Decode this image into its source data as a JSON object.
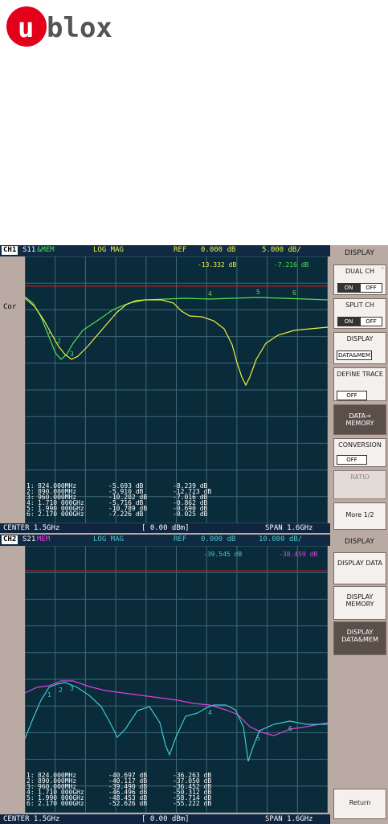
{
  "brand": {
    "name": "ublox",
    "logo_color": "#e2001a"
  },
  "ch1": {
    "label": "CH1",
    "trace": "S11",
    "trace_mem": "&MEM",
    "format": "LOG MAG",
    "ref_label": "REF",
    "ref_value": "0.000 dB",
    "scale": "5.000 dB/",
    "marker_readout_1": "-13.332 dB",
    "marker_readout_2": "-7.216 dB",
    "cor": "Cor",
    "center": "CENTER 1.5GHz",
    "power": "[ 0.00 dBm]",
    "span": "SPAN 1.6GHz",
    "markers": [
      {
        "n": "1:",
        "freq": "824.000MHz",
        "a": "-5.693 dB",
        "b": "-8.239 dB"
      },
      {
        "n": "2:",
        "freq": "890.000MHz",
        "a": "-5.910 dB",
        "b": "-12.723 dB"
      },
      {
        "n": "3:",
        "freq": "960.000MHz",
        "a": "-10.202 dB",
        "b": "-7.016 dB"
      },
      {
        "n": "4:",
        "freq": "1.710 000GHz",
        "a": "-5.716 dB",
        "b": "-0.862 dB"
      },
      {
        "n": "5:",
        "freq": "1.990 000GHz",
        "a": "-10.789 dB",
        "b": "-0.690 dB"
      },
      {
        "n": "6:",
        "freq": "2.170 000GHz",
        "a": "-7.226 dB",
        "b": "-0.025 dB"
      }
    ]
  },
  "ch2": {
    "label": "CH2",
    "trace": "S21",
    "trace_mem": "MEM",
    "format": "LOG MAG",
    "ref_label": "REF",
    "ref_value": "0.000 dB",
    "scale": "10.000 dB/",
    "marker_readout_1": "-39.545 dB",
    "marker_readout_2": "-38.459 dB",
    "center": "CENTER 1.5GHz",
    "power": "[ 0.00 dBm]",
    "span": "SPAN 1.6GHz",
    "markers": [
      {
        "n": "1:",
        "freq": "824.000MHz",
        "a": "-40.697 dB",
        "b": "-36.263 dB"
      },
      {
        "n": "2:",
        "freq": "890.000MHz",
        "a": "-40.117 dB",
        "b": "-37.050 dB"
      },
      {
        "n": "3:",
        "freq": "960.000MHz",
        "a": "-39.490 dB",
        "b": "-36.452 dB"
      },
      {
        "n": "4:",
        "freq": "1.710 000GHz",
        "a": "-46.496 dB",
        "b": "-50.312 dB"
      },
      {
        "n": "5:",
        "freq": "1.990 000GHz",
        "a": "-48.453 dB",
        "b": "-58.714 dB"
      },
      {
        "n": "6:",
        "freq": "2.170 000GHz",
        "a": "-52.626 dB",
        "b": "-55.222 dB"
      }
    ]
  },
  "softkeys1": {
    "title": "DISPLAY",
    "dual_ch": "DUAL CH",
    "split_ch": "SPLIT CH",
    "on": "ON",
    "off": "OFF",
    "display": "DISPLAY",
    "display_value": "DATA&MEM",
    "define_trace": "DEFINE TRACE",
    "define_value": "OFF",
    "data_memory": "DATA→ MEMORY",
    "conversion": "CONVERSION",
    "conversion_value": "OFF",
    "ratio": "RATIO",
    "more": "More 1/2"
  },
  "softkeys2": {
    "title": "DISPLAY",
    "display_data": "DISPLAY DATA",
    "display_memory": "DISPLAY MEMORY",
    "display_datamem": "DISPLAY DATA&MEM",
    "return": "Return"
  },
  "colors": {
    "data_ch1": "#f0f040",
    "mem_ch1": "#50e050",
    "data_ch2": "#e040e0",
    "mem_ch2": "#40c8d0",
    "grid": "#3e6a77",
    "ref_line": "#c02020"
  }
}
